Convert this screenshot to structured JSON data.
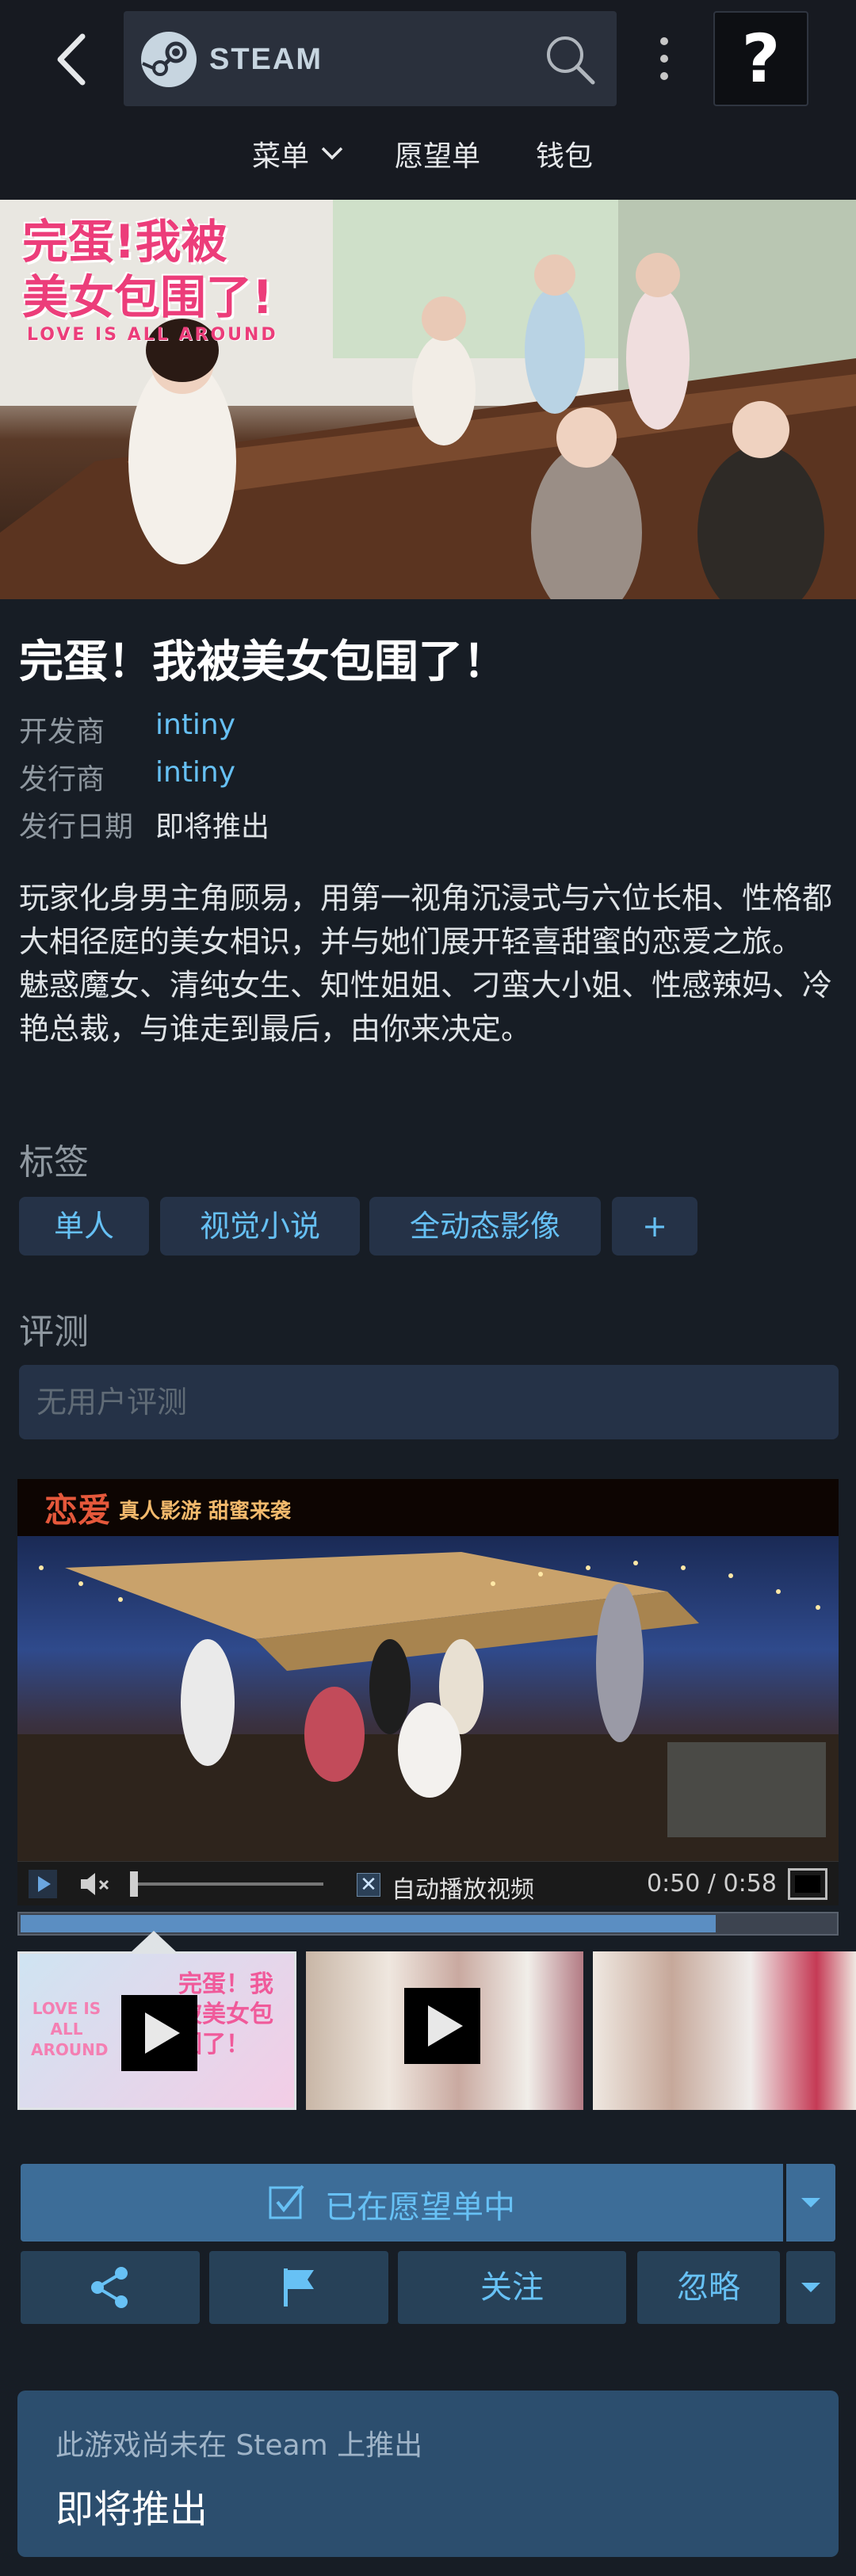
{
  "nav": {
    "brand": "STEAM",
    "help": "?",
    "menu_label": "菜单",
    "wishlist_label": "愿望单",
    "wallet_label": "钱包"
  },
  "header_image": {
    "title_line1": "完蛋!我被",
    "title_line2": "美女包围了!",
    "subtitle": "LOVE IS ALL AROUND"
  },
  "game": {
    "title": "完蛋！我被美女包围了！",
    "developer_label": "开发商",
    "developer": "intiny",
    "publisher_label": "发行商",
    "publisher": "intiny",
    "release_label": "发行日期",
    "release_value": "即将推出",
    "description": "玩家化身男主角顾易，用第一视角沉浸式与六位长相、性格都大相径庭的美女相识，并与她们展开轻喜甜蜜的恋爱之旅。 魅惑魔女、清纯女生、知性姐姐、刁蛮大小姐、性感辣妈、冷艳总裁，与谁走到最后，由你来决定。"
  },
  "tags": {
    "title": "标签",
    "items": [
      "单人",
      "视觉小说",
      "全动态影像",
      "+"
    ]
  },
  "reviews": {
    "title": "评测",
    "empty_text": "无用户评测"
  },
  "media": {
    "banner_a": "恋爱",
    "banner_b": "真人影游 甜蜜来袭",
    "autoplay_label": "自动播放视频",
    "autoplay_check": "✕",
    "time": "0:50 / 0:58",
    "progress": 0.85,
    "thumb1_text_a": "LOVE IS ALL AROUND",
    "thumb1_text_b": "完蛋！我被美女包围了！"
  },
  "actions": {
    "wishlist_label": "已在愿望单中",
    "follow_label": "关注",
    "ignore_label": "忽略"
  },
  "release_box": {
    "note": "此游戏尚未在 Steam 上推出",
    "status": "即将推出"
  },
  "colors": {
    "page_bg": "#171d25",
    "link": "#66c0f4",
    "tag_bg": "#253247",
    "button_bg": "#274158",
    "wishlist_bg": "#3d6d98",
    "release_bg": "#2c4e6e"
  }
}
